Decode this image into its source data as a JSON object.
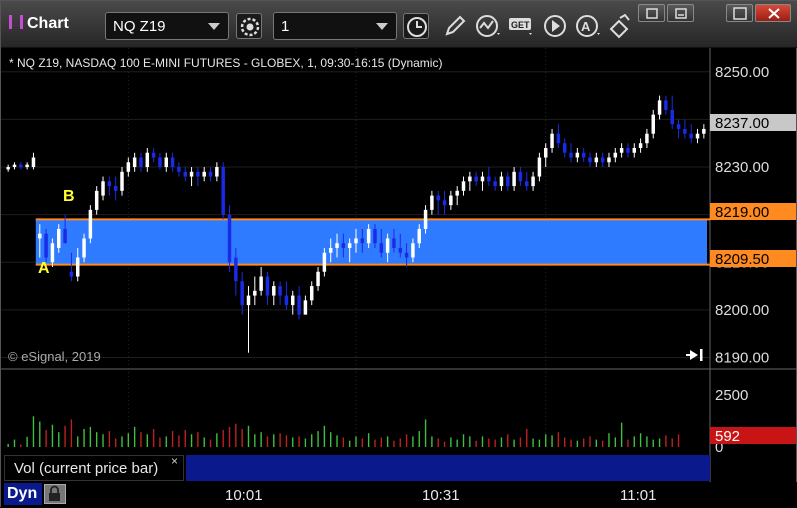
{
  "window": {
    "title": "Chart",
    "symbol_value": "NQ Z19",
    "interval_value": "1"
  },
  "chart": {
    "header": "* NQ Z19, NASDAQ 100 E-MINI FUTURES - GLOBEX, 1, 09:30-16:15 (Dynamic)",
    "copyright": "© eSignal, 2019",
    "label_a": "A",
    "label_b": "B",
    "colors": {
      "up": "#ffffff",
      "down": "#1a2be8",
      "band": "#2f7bff",
      "level_line": "#ff8a1f",
      "vol_up": "#3fbf3f",
      "vol_down": "#c02020"
    }
  },
  "price_axis": {
    "ticks": [
      "8250.00",
      "8240.00",
      "8230.00",
      "8220.00",
      "8210.00",
      "8200.00",
      "8190.00"
    ],
    "last_price": "8237.00",
    "level_high": "8219.00",
    "level_low": "8209.50"
  },
  "volume_axis": {
    "ticks": [
      "2500",
      "0"
    ],
    "current": "592"
  },
  "volume_pane": {
    "label": "Vol (current price bar)",
    "close": "×"
  },
  "bottom": {
    "mode": "Dyn",
    "times": [
      "10:01",
      "10:31",
      "11:01"
    ]
  },
  "chart_data": {
    "type": "candlestick",
    "x_start": "09:42",
    "x_step_minutes": 1,
    "price_range": [
      8188,
      8255
    ],
    "levels": [
      8219.0,
      8209.5
    ],
    "ohlc": [
      [
        8229.5,
        8230.5,
        8229,
        8230
      ],
      [
        8230,
        8231,
        8229.5,
        8230.5
      ],
      [
        8230.5,
        8231,
        8229.5,
        8230
      ],
      [
        8230,
        8231,
        8229.5,
        8230.5
      ],
      [
        8230,
        8233,
        8229.5,
        8232
      ],
      [
        8215,
        8218,
        8211,
        8216
      ],
      [
        8216,
        8217,
        8210,
        8211
      ],
      [
        8210,
        8215,
        8209,
        8214
      ],
      [
        8213,
        8218,
        8212,
        8217
      ],
      [
        8217,
        8220,
        8214,
        8214
      ],
      [
        8208,
        8212,
        8206,
        8207
      ],
      [
        8207,
        8213,
        8206,
        8211
      ],
      [
        8211,
        8216,
        8210,
        8215
      ],
      [
        8215,
        8222,
        8214,
        8221
      ],
      [
        8221,
        8226,
        8220,
        8225
      ],
      [
        8224,
        8228,
        8223,
        8227
      ],
      [
        8227,
        8228,
        8224,
        8226
      ],
      [
        8226,
        8228,
        8223,
        8225
      ],
      [
        8225,
        8230,
        8224,
        8229
      ],
      [
        8229,
        8232,
        8228,
        8231
      ],
      [
        8230,
        8233,
        8229,
        8232
      ],
      [
        8232,
        8233,
        8229,
        8230
      ],
      [
        8230,
        8234,
        8229,
        8233
      ],
      [
        8233,
        8234,
        8231,
        8232
      ],
      [
        8232,
        8233,
        8229.5,
        8230
      ],
      [
        8230,
        8233,
        8229,
        8232
      ],
      [
        8232,
        8233,
        8229,
        8230
      ],
      [
        8230,
        8231,
        8228,
        8229
      ],
      [
        8229,
        8230,
        8227,
        8228
      ],
      [
        8228,
        8230,
        8226,
        8229
      ],
      [
        8229,
        8230,
        8226,
        8228
      ],
      [
        8228,
        8230,
        8227,
        8229
      ],
      [
        8229,
        8230,
        8227,
        8228
      ],
      [
        8228,
        8231,
        8227,
        8230
      ],
      [
        8230,
        8231,
        8219,
        8220
      ],
      [
        8220,
        8222,
        8208,
        8210
      ],
      [
        8211,
        8213,
        8203,
        8206
      ],
      [
        8206,
        8208,
        8199,
        8201
      ],
      [
        8201,
        8205,
        8191,
        8203
      ],
      [
        8203,
        8207,
        8201,
        8204
      ],
      [
        8204,
        8209,
        8203,
        8207
      ],
      [
        8207,
        8208,
        8201,
        8203
      ],
      [
        8203,
        8206,
        8201,
        8205
      ],
      [
        8205,
        8206,
        8201,
        8203
      ],
      [
        8203,
        8206,
        8200,
        8201
      ],
      [
        8201,
        8204,
        8199,
        8203
      ],
      [
        8203,
        8205,
        8198,
        8199
      ],
      [
        8199,
        8203,
        8199,
        8202
      ],
      [
        8202,
        8206,
        8201,
        8205
      ],
      [
        8205,
        8209,
        8204,
        8208
      ],
      [
        8208,
        8213,
        8207,
        8212
      ],
      [
        8212,
        8215,
        8210,
        8213
      ],
      [
        8213,
        8216,
        8211,
        8214
      ],
      [
        8214,
        8216,
        8211,
        8213
      ],
      [
        8213,
        8215,
        8210,
        8214
      ],
      [
        8214,
        8217,
        8212,
        8215
      ],
      [
        8215,
        8217,
        8212,
        8214
      ],
      [
        8214,
        8218,
        8213,
        8217
      ],
      [
        8217,
        8218,
        8213,
        8214
      ],
      [
        8214,
        8217,
        8211,
        8212
      ],
      [
        8212,
        8216,
        8210,
        8215
      ],
      [
        8215,
        8217,
        8212,
        8213
      ],
      [
        8213,
        8216,
        8211,
        8212
      ],
      [
        8212,
        8214,
        8209,
        8211
      ],
      [
        8211,
        8215,
        8210,
        8214
      ],
      [
        8214,
        8218,
        8213,
        8217
      ],
      [
        8217,
        8222,
        8216,
        8221
      ],
      [
        8221,
        8225,
        8220,
        8224
      ],
      [
        8224,
        8225,
        8220,
        8223
      ],
      [
        8223,
        8225,
        8220,
        8222
      ],
      [
        8222,
        8225,
        8221,
        8224
      ],
      [
        8224,
        8226,
        8222,
        8225
      ],
      [
        8225,
        8228,
        8224,
        8227
      ],
      [
        8227,
        8229,
        8225,
        8228
      ],
      [
        8228,
        8229,
        8226,
        8227
      ],
      [
        8227,
        8229,
        8225,
        8228
      ],
      [
        8228,
        8230,
        8226,
        8227
      ],
      [
        8227,
        8228,
        8225,
        8226
      ],
      [
        8226,
        8229,
        8225,
        8228
      ],
      [
        8228,
        8229,
        8225,
        8226
      ],
      [
        8226,
        8230,
        8225,
        8229
      ],
      [
        8229,
        8230,
        8226,
        8227
      ],
      [
        8227,
        8229,
        8225,
        8226
      ],
      [
        8226,
        8229,
        8225,
        8228
      ],
      [
        8228,
        8233,
        8227,
        8232
      ],
      [
        8232,
        8235,
        8230,
        8234
      ],
      [
        8234,
        8238,
        8233,
        8237
      ],
      [
        8237,
        8239,
        8234,
        8235
      ],
      [
        8235,
        8236,
        8232,
        8233
      ],
      [
        8233,
        8235,
        8231,
        8232
      ],
      [
        8232,
        8234,
        8231,
        8233
      ],
      [
        8233,
        8234,
        8231,
        8232
      ],
      [
        8232,
        8233,
        8230,
        8231
      ],
      [
        8231,
        8233,
        8230,
        8232
      ],
      [
        8232,
        8233,
        8230,
        8231
      ],
      [
        8231,
        8233,
        8230,
        8232
      ],
      [
        8232,
        8234,
        8231,
        8233
      ],
      [
        8233,
        8235,
        8232,
        8234
      ],
      [
        8234,
        8235,
        8232,
        8233
      ],
      [
        8233,
        8235,
        8232,
        8234
      ],
      [
        8234,
        8236,
        8233,
        8235
      ],
      [
        8235,
        8238,
        8234,
        8237
      ],
      [
        8237,
        8242,
        8236,
        8241
      ],
      [
        8241,
        8245,
        8240,
        8244
      ],
      [
        8244,
        8245,
        8241,
        8242
      ],
      [
        8242,
        8245,
        8238,
        8239
      ],
      [
        8239,
        8240,
        8236,
        8238
      ],
      [
        8238,
        8240,
        8236,
        8237
      ],
      [
        8237,
        8239,
        8235,
        8236
      ],
      [
        8236,
        8238,
        8235,
        8237
      ],
      [
        8237,
        8239,
        8236,
        8238
      ]
    ],
    "volume": [
      150,
      350,
      120,
      480,
      1450,
      1200,
      800,
      1050,
      700,
      1000,
      1300,
      500,
      850,
      950,
      700,
      600,
      750,
      400,
      500,
      650,
      950,
      700,
      600,
      850,
      450,
      500,
      750,
      550,
      800,
      600,
      700,
      450,
      350,
      650,
      800,
      950,
      1100,
      850,
      1000,
      600,
      700,
      500,
      600,
      650,
      550,
      450,
      500,
      400,
      600,
      750,
      1000,
      700,
      550,
      450,
      300,
      500,
      400,
      650,
      350,
      450,
      500,
      300,
      400,
      600,
      500,
      750,
      1300,
      500,
      400,
      250,
      450,
      350,
      600,
      500,
      300,
      500,
      400,
      350,
      450,
      600,
      350,
      450,
      850,
      400,
      350,
      600,
      550,
      700,
      450,
      350,
      300,
      400,
      500,
      350,
      300,
      650,
      450,
      1150,
      350,
      500,
      650,
      500,
      350,
      400,
      550,
      400,
      592
    ]
  }
}
